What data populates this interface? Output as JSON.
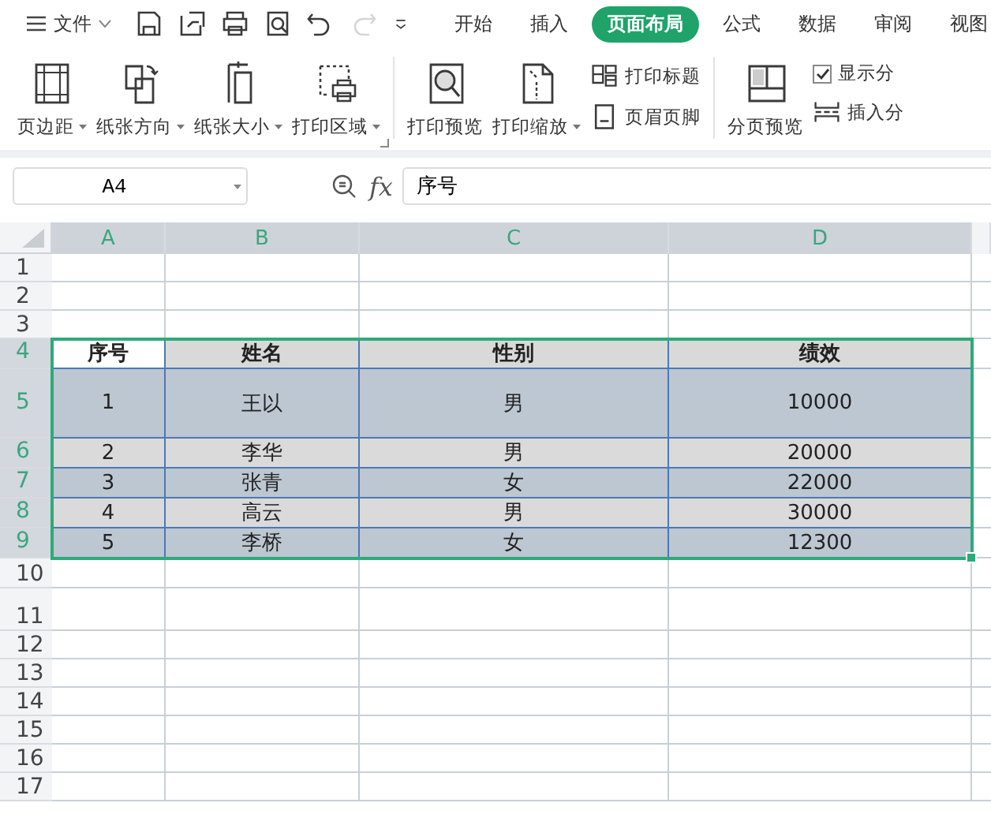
{
  "menu": {
    "label": "文件"
  },
  "quick_access": [
    {
      "kind": "save",
      "disabled": false
    },
    {
      "kind": "export",
      "disabled": false
    },
    {
      "kind": "print",
      "disabled": false
    },
    {
      "kind": "preview",
      "disabled": false
    },
    {
      "kind": "undo",
      "disabled": false
    },
    {
      "kind": "redo",
      "disabled": true
    },
    {
      "kind": "more",
      "disabled": false
    }
  ],
  "tabs": [
    {
      "label": "开始",
      "selected": false
    },
    {
      "label": "插入",
      "selected": false
    },
    {
      "label": "页面布局",
      "selected": true
    },
    {
      "label": "公式",
      "selected": false
    },
    {
      "label": "数据",
      "selected": false
    },
    {
      "label": "审阅",
      "selected": false
    },
    {
      "label": "视图",
      "selected": false
    }
  ],
  "ribbon": [
    {
      "kind": "big",
      "label": "页边距",
      "dropdown": true
    },
    {
      "kind": "big",
      "label": "纸张方向",
      "dropdown": true
    },
    {
      "kind": "big",
      "label": "纸张大小",
      "dropdown": true
    },
    {
      "kind": "big",
      "label": "打印区域",
      "dropdown": true
    },
    {
      "kind": "divider"
    },
    {
      "kind": "big",
      "label": "打印预览",
      "dropdown": false
    },
    {
      "kind": "big",
      "label": "打印缩放",
      "dropdown": true
    },
    {
      "kind": "stack",
      "items": [
        {
          "kind": "small",
          "label": "打印标题"
        },
        {
          "kind": "small",
          "label": "页眉页脚"
        }
      ]
    },
    {
      "kind": "divider"
    },
    {
      "kind": "big",
      "label": "分页预览",
      "dropdown": false
    },
    {
      "kind": "stack",
      "items": [
        {
          "kind": "check",
          "label": "显示分",
          "checked": true
        },
        {
          "kind": "small",
          "label": "插入分"
        }
      ]
    }
  ],
  "formula_bar": {
    "name_box": "A4",
    "fx": "fx",
    "formula": "序号"
  },
  "columns": [
    {
      "label": "A",
      "selected": true
    },
    {
      "label": "B",
      "selected": true
    },
    {
      "label": "C",
      "selected": true
    },
    {
      "label": "D",
      "selected": true
    }
  ],
  "rows": [
    {
      "label": "1",
      "selected": false
    },
    {
      "label": "2",
      "selected": false
    },
    {
      "label": "3",
      "selected": false
    },
    {
      "label": "4",
      "selected": true,
      "kind": "header",
      "color": "#d9d9d9",
      "cells": [
        {
          "text": "序号",
          "active": true
        },
        {
          "text": "姓名",
          "active": false
        },
        {
          "text": "性别",
          "active": false
        },
        {
          "text": "绩效",
          "active": false
        }
      ]
    },
    {
      "label": "5",
      "selected": true,
      "kind": "data",
      "color": "#bdc7d1",
      "cells": [
        {
          "text": "1",
          "active": false
        },
        {
          "text": "王以",
          "active": false
        },
        {
          "text": "男",
          "active": false
        },
        {
          "text": "10000",
          "active": false
        }
      ]
    },
    {
      "label": "6",
      "selected": true,
      "kind": "data",
      "color": "#dadada",
      "cells": [
        {
          "text": "2",
          "active": false
        },
        {
          "text": "李华",
          "active": false
        },
        {
          "text": "男",
          "active": false
        },
        {
          "text": "20000",
          "active": false
        }
      ]
    },
    {
      "label": "7",
      "selected": true,
      "kind": "data",
      "color": "#bdc7d1",
      "cells": [
        {
          "text": "3",
          "active": false
        },
        {
          "text": "张青",
          "active": false
        },
        {
          "text": "女",
          "active": false
        },
        {
          "text": "22000",
          "active": false
        }
      ]
    },
    {
      "label": "8",
      "selected": true,
      "kind": "data",
      "color": "#dadada",
      "cells": [
        {
          "text": "4",
          "active": false
        },
        {
          "text": "高云",
          "active": false
        },
        {
          "text": "男",
          "active": false
        },
        {
          "text": "30000",
          "active": false
        }
      ]
    },
    {
      "label": "9",
      "selected": true,
      "kind": "data",
      "color": "#bdc7d1",
      "cells": [
        {
          "text": "5",
          "active": false
        },
        {
          "text": "李桥",
          "active": false
        },
        {
          "text": "女",
          "active": false
        },
        {
          "text": "12300",
          "active": false
        }
      ]
    },
    {
      "label": "10",
      "selected": false
    },
    {
      "label": "11",
      "selected": false
    },
    {
      "label": "12",
      "selected": false
    },
    {
      "label": "13",
      "selected": false
    },
    {
      "label": "14",
      "selected": false
    },
    {
      "label": "15",
      "selected": false
    },
    {
      "label": "16",
      "selected": false
    },
    {
      "label": "17",
      "selected": false
    }
  ]
}
